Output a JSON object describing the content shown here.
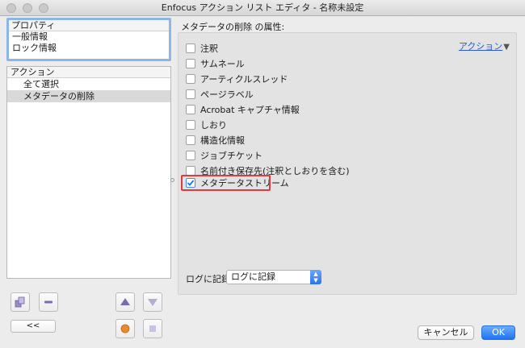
{
  "window": {
    "title": "Enfocus アクション リスト エディタ - 名称未設定"
  },
  "properties": {
    "header": "プロパティ",
    "items": [
      "一般情報",
      "ロック情報"
    ]
  },
  "actions": {
    "header": "アクション",
    "items": [
      {
        "label": "全て選択",
        "selected": false
      },
      {
        "label": "メタデータの削除",
        "selected": true
      }
    ]
  },
  "left_toolbar": {
    "collapse_label": "<<",
    "icons": [
      "copy-action-icon",
      "delete-action-icon",
      "move-up-icon",
      "move-down-icon",
      "record-icon",
      "stop-icon"
    ]
  },
  "attributes": {
    "title": "メタデータの削除 の属性:",
    "action_link": "アクション",
    "checkboxes": [
      {
        "label": "注釈",
        "checked": false
      },
      {
        "label": "サムネール",
        "checked": false
      },
      {
        "label": "アーティクルスレッド",
        "checked": false
      },
      {
        "label": "ページラベル",
        "checked": false
      },
      {
        "label": "Acrobat キャプチャ情報",
        "checked": false
      },
      {
        "label": "しおり",
        "checked": false
      },
      {
        "label": "構造化情報",
        "checked": false
      },
      {
        "label": "ジョブチケット",
        "checked": false
      },
      {
        "label": "名前付き保存先(注釈としおりを含む)",
        "checked": false
      },
      {
        "label": "メタデータストリーム",
        "checked": true
      }
    ],
    "log_label": "ログに記録",
    "log_value": "ログに記録"
  },
  "buttons": {
    "cancel": "キャンセル",
    "ok": "OK"
  },
  "colors": {
    "accent": "#1d73f5",
    "highlight": "#e0393e",
    "selection": "#d9d9d9"
  }
}
